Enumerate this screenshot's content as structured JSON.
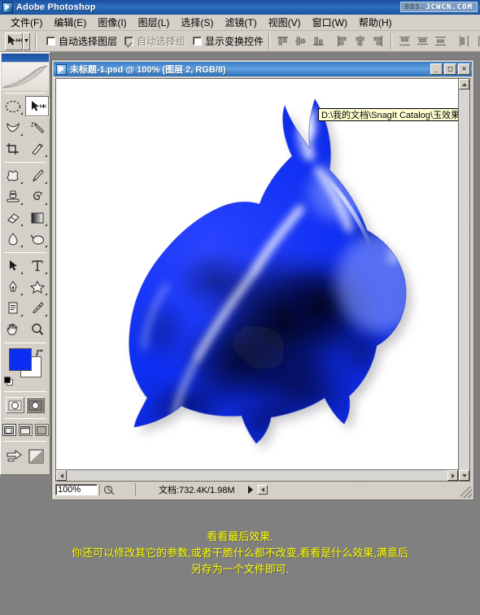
{
  "app": {
    "title": "Adobe Photoshop",
    "logo_icon": "photoshop-logo-icon",
    "watermark_prefix": "BBS.",
    "watermark_suffix": "JCWCN.COM"
  },
  "menubar": {
    "items": [
      {
        "label": "文件(F)",
        "name": "menu-file"
      },
      {
        "label": "编辑(E)",
        "name": "menu-edit"
      },
      {
        "label": "图像(I)",
        "name": "menu-image"
      },
      {
        "label": "图层(L)",
        "name": "menu-layer"
      },
      {
        "label": "选择(S)",
        "name": "menu-select"
      },
      {
        "label": "滤镜(T)",
        "name": "menu-filter"
      },
      {
        "label": "视图(V)",
        "name": "menu-view"
      },
      {
        "label": "窗口(W)",
        "name": "menu-window"
      },
      {
        "label": "帮助(H)",
        "name": "menu-help"
      }
    ]
  },
  "options_bar": {
    "active_tool_icon": "move-tool-icon",
    "preset_dropdown_icon": "chevron-down-icon",
    "checkboxes": [
      {
        "label": "自动选择图层",
        "checked": false,
        "disabled": false,
        "name": "auto-select-layer-checkbox"
      },
      {
        "label": "自动选择组",
        "checked": true,
        "disabled": true,
        "name": "auto-select-group-checkbox"
      },
      {
        "label": "显示变换控件",
        "checked": false,
        "disabled": false,
        "name": "show-transform-controls-checkbox"
      }
    ],
    "align_icons": [
      "align-top-edges-icon",
      "align-vertical-centers-icon",
      "align-bottom-edges-icon",
      "align-left-edges-icon",
      "align-horizontal-centers-icon",
      "align-right-edges-icon"
    ],
    "distribute_icons": [
      "distribute-top-edges-icon",
      "distribute-vertical-centers-icon",
      "distribute-bottom-edges-icon",
      "distribute-left-edges-icon",
      "distribute-horizontal-centers-icon"
    ]
  },
  "toolbox": {
    "banner_icon": "feather-banner-icon",
    "tools": [
      {
        "name": "marquee-tool",
        "icon": "elliptical-marquee-icon",
        "active": false,
        "has_flyout": true
      },
      {
        "name": "move-tool",
        "icon": "move-tool-icon",
        "active": true,
        "has_flyout": false
      },
      {
        "name": "lasso-tool",
        "icon": "lasso-icon",
        "active": false,
        "has_flyout": true
      },
      {
        "name": "magic-wand-tool",
        "icon": "magic-wand-icon",
        "active": false,
        "has_flyout": false
      },
      {
        "name": "crop-tool",
        "icon": "crop-icon",
        "active": false,
        "has_flyout": false
      },
      {
        "name": "slice-tool",
        "icon": "slice-knife-icon",
        "active": false,
        "has_flyout": true
      },
      {
        "name": "healing-brush-tool",
        "icon": "healing-patch-icon",
        "active": false,
        "has_flyout": true
      },
      {
        "name": "brush-tool",
        "icon": "paintbrush-icon",
        "active": false,
        "has_flyout": true
      },
      {
        "name": "clone-stamp-tool",
        "icon": "clone-stamp-icon",
        "active": false,
        "has_flyout": true
      },
      {
        "name": "history-brush-tool",
        "icon": "history-brush-icon",
        "active": false,
        "has_flyout": true
      },
      {
        "name": "eraser-tool",
        "icon": "eraser-icon",
        "active": false,
        "has_flyout": true
      },
      {
        "name": "gradient-tool",
        "icon": "gradient-icon",
        "active": false,
        "has_flyout": true
      },
      {
        "name": "blur-tool",
        "icon": "blur-droplet-icon",
        "active": false,
        "has_flyout": true
      },
      {
        "name": "dodge-tool",
        "icon": "dodge-icon",
        "active": false,
        "has_flyout": true
      },
      {
        "name": "path-selection-tool",
        "icon": "path-arrow-icon",
        "active": false,
        "has_flyout": true
      },
      {
        "name": "type-tool",
        "icon": "type-t-icon",
        "active": false,
        "has_flyout": true
      },
      {
        "name": "pen-tool",
        "icon": "pen-nib-icon",
        "active": false,
        "has_flyout": true
      },
      {
        "name": "custom-shape-tool",
        "icon": "custom-shape-icon",
        "active": false,
        "has_flyout": true
      },
      {
        "name": "notes-tool",
        "icon": "notes-icon",
        "active": false,
        "has_flyout": true
      },
      {
        "name": "eyedropper-tool",
        "icon": "eyedropper-icon",
        "active": false,
        "has_flyout": true
      },
      {
        "name": "hand-tool",
        "icon": "hand-icon",
        "active": false,
        "has_flyout": false
      },
      {
        "name": "zoom-tool",
        "icon": "magnifier-icon",
        "active": false,
        "has_flyout": false
      }
    ],
    "colors": {
      "foreground": "#0b2ef0",
      "background": "#ffffff",
      "swap_icon": "swap-colors-icon",
      "default_icon": "default-colors-icon"
    },
    "mask_modes": [
      {
        "name": "standard-mode-button",
        "icon": "standard-mask-icon",
        "selected": false
      },
      {
        "name": "quick-mask-mode-button",
        "icon": "quick-mask-icon",
        "selected": true
      }
    ],
    "screen_modes": [
      {
        "name": "standard-screen-mode-button",
        "icon": "standard-screen-icon",
        "selected": true
      },
      {
        "name": "full-screen-menubar-mode-button",
        "icon": "full-screen-menubar-icon",
        "selected": false
      },
      {
        "name": "full-screen-mode-button",
        "icon": "full-screen-icon",
        "selected": false
      }
    ],
    "jump_buttons": [
      {
        "name": "jump-to-imageready-button",
        "icon": "jump-to-imageready-icon"
      },
      {
        "name": "imageready-logo",
        "icon": "imageready-icon"
      }
    ]
  },
  "document_window": {
    "icon": "document-icon",
    "title": "未标题-1.psd @ 100% (图层 2, RGB/8)",
    "window_buttons": [
      {
        "name": "minimize-button",
        "glyph": "_"
      },
      {
        "name": "maximize-button",
        "glyph": "□"
      },
      {
        "name": "close-button",
        "glyph": "✕"
      }
    ],
    "tooltip_text": "D:\\我的文档\\SnagIt Catalog\\玉效果制",
    "canvas": {
      "artwork_name": "blue-jade-rabbit",
      "background": "#ffffff",
      "rabbit_base_color": "#0b2ef0",
      "rabbit_dark_color": "#101018",
      "rabbit_highlight_color": "#ffffff"
    },
    "status_bar": {
      "zoom_value": "100%",
      "preview_icon": "preview-thumb-icon",
      "doc_size_label": "文档:732.4K/1.98M",
      "menu_arrow_icon": "triangle-right-icon",
      "proxy_icon": "status-proxy-icon"
    },
    "scrollbars": {
      "vertical_up_icon": "triangle-up-icon",
      "vertical_down_icon": "triangle-down-icon",
      "horizontal_left_icon": "triangle-left-icon",
      "horizontal_right_icon": "triangle-right-icon",
      "resize_grip_icon": "resize-grip-icon"
    }
  },
  "caption": {
    "color": "#ffff00",
    "lines": [
      "看看最后效果.",
      "你还可以修改其它的参数,或者干脆什么都不改变,看看是什么效果,满意后",
      "另存为一个文件即可."
    ]
  }
}
